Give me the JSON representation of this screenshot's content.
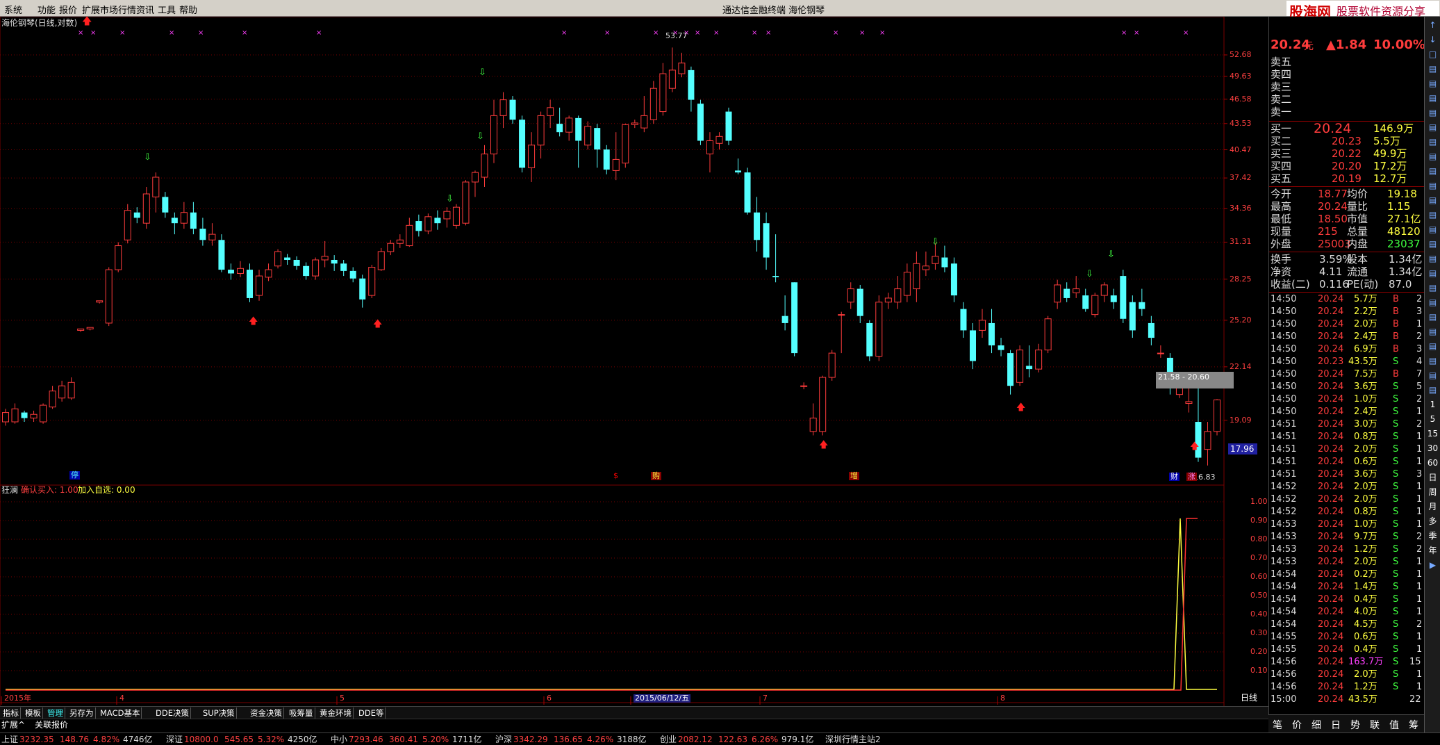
{
  "menu": [
    "系统",
    "功能",
    "报价",
    "扩展市场行情",
    "资讯",
    "工具",
    "帮助"
  ],
  "window_title": "通达信金融终端  海伦钢琴",
  "logo": {
    "name": "股海网",
    "slogan": "股票软件资源分享",
    "url": "www.Guhai.com.cn"
  },
  "chart_title": "海伦钢琴(日线,对数)",
  "yaxis_labels": [
    "52.68",
    "49.63",
    "46.58",
    "43.53",
    "40.47",
    "37.42",
    "34.36",
    "31.31",
    "28.25",
    "25.20",
    "22.14",
    "19.09"
  ],
  "price_box": "17.96",
  "high_label": "53.77",
  "low_label": "16.83",
  "range_label": "21.58 - 20.60",
  "event_labels": [
    "停",
    "$",
    "购",
    "增",
    "财",
    "涨"
  ],
  "indicator": {
    "name": "狂澜",
    "line1": "确认买入: 1.00",
    "line2": "加入自选: 0.00",
    "ticks": [
      "1.00",
      "0.90",
      "0.80",
      "0.70",
      "0.60",
      "0.50",
      "0.40",
      "0.30",
      "0.20",
      "0.10"
    ]
  },
  "xaxis_labels": [
    "2015年",
    "4",
    "5",
    "6",
    "2015/06/12/五",
    "7",
    "8"
  ],
  "period": "日线",
  "tabs": [
    "指标",
    "模板",
    "管理",
    "另存为",
    "MACD基本",
    "DDE决策",
    "SUP决策",
    "资金决策",
    "吸筹量",
    "黄金环境",
    "DDE等"
  ],
  "tabs2": [
    "扩展^",
    "关联报价"
  ],
  "quote": {
    "price": "20.24",
    "unit": "元",
    "change": "▲1.84",
    "pct": "10.00%",
    "sells": [
      {
        "label": "卖五"
      },
      {
        "label": "卖四"
      },
      {
        "label": "卖三"
      },
      {
        "label": "卖二"
      },
      {
        "label": "卖一"
      }
    ],
    "buys": [
      {
        "label": "买一",
        "price": "20.24",
        "vol": "146.9万"
      },
      {
        "label": "买二",
        "price": "20.23",
        "vol": "5.5万"
      },
      {
        "label": "买三",
        "price": "20.22",
        "vol": "49.9万"
      },
      {
        "label": "买四",
        "price": "20.20",
        "vol": "17.2万"
      },
      {
        "label": "买五",
        "price": "20.19",
        "vol": "12.7万"
      }
    ],
    "stats": [
      {
        "k1": "今开",
        "v1": "18.77",
        "k2": "均价",
        "v2": "19.18"
      },
      {
        "k1": "最高",
        "v1": "20.24",
        "k2": "量比",
        "v2": "1.15"
      },
      {
        "k1": "最低",
        "v1": "18.50",
        "k2": "市值",
        "v2": "27.1亿"
      },
      {
        "k1": "现量",
        "v1": "215",
        "k2": "总量",
        "v2": "48120"
      },
      {
        "k1": "外盘",
        "v1": "25003",
        "k2": "内盘",
        "v2": "23037"
      }
    ],
    "stats2": [
      {
        "k1": "换手",
        "v1": "3.59%",
        "k2": "股本",
        "v2": "1.34亿"
      },
      {
        "k1": "净资",
        "v1": "4.11",
        "k2": "流通",
        "v2": "1.34亿"
      },
      {
        "k1": "收益(二)",
        "v1": "0.116",
        "k2": "PE(动)",
        "v2": "87.0"
      }
    ],
    "trades": [
      [
        "14:50",
        "20.24",
        "5.7万",
        "B",
        "2"
      ],
      [
        "14:50",
        "20.24",
        "2.2万",
        "B",
        "3"
      ],
      [
        "14:50",
        "20.24",
        "2.0万",
        "B",
        "1"
      ],
      [
        "14:50",
        "20.24",
        "2.4万",
        "B",
        "2"
      ],
      [
        "14:50",
        "20.24",
        "6.9万",
        "B",
        "3"
      ],
      [
        "14:50",
        "20.23",
        "43.5万",
        "S",
        "4"
      ],
      [
        "14:50",
        "20.24",
        "7.5万",
        "B",
        "7"
      ],
      [
        "14:50",
        "20.24",
        "3.6万",
        "S",
        "5"
      ],
      [
        "14:50",
        "20.24",
        "1.0万",
        "S",
        "2"
      ],
      [
        "14:50",
        "20.24",
        "2.4万",
        "S",
        "1"
      ],
      [
        "14:51",
        "20.24",
        "3.0万",
        "S",
        "2"
      ],
      [
        "14:51",
        "20.24",
        "0.8万",
        "S",
        "1"
      ],
      [
        "14:51",
        "20.24",
        "2.0万",
        "S",
        "1"
      ],
      [
        "14:51",
        "20.24",
        "0.6万",
        "S",
        "1"
      ],
      [
        "14:51",
        "20.24",
        "3.6万",
        "S",
        "3"
      ],
      [
        "14:52",
        "20.24",
        "2.0万",
        "S",
        "1"
      ],
      [
        "14:52",
        "20.24",
        "2.0万",
        "S",
        "1"
      ],
      [
        "14:52",
        "20.24",
        "0.8万",
        "S",
        "1"
      ],
      [
        "14:53",
        "20.24",
        "1.0万",
        "S",
        "1"
      ],
      [
        "14:53",
        "20.24",
        "9.7万",
        "S",
        "2"
      ],
      [
        "14:53",
        "20.24",
        "1.2万",
        "S",
        "2"
      ],
      [
        "14:53",
        "20.24",
        "2.0万",
        "S",
        "1"
      ],
      [
        "14:54",
        "20.24",
        "0.2万",
        "S",
        "1"
      ],
      [
        "14:54",
        "20.24",
        "1.4万",
        "S",
        "1"
      ],
      [
        "14:54",
        "20.24",
        "0.4万",
        "S",
        "1"
      ],
      [
        "14:54",
        "20.24",
        "4.0万",
        "S",
        "1"
      ],
      [
        "14:54",
        "20.24",
        "4.5万",
        "S",
        "2"
      ],
      [
        "14:55",
        "20.24",
        "0.6万",
        "S",
        "1"
      ],
      [
        "14:55",
        "20.24",
        "0.4万",
        "S",
        "1"
      ],
      [
        "14:56",
        "20.24",
        "163.7万",
        "S",
        "15"
      ],
      [
        "14:56",
        "20.24",
        "2.0万",
        "S",
        "1"
      ],
      [
        "14:56",
        "20.24",
        "1.2万",
        "S",
        "1"
      ],
      [
        "15:00",
        "20.24",
        "43.5万",
        "",
        "22"
      ]
    ],
    "bottom_tabs": [
      "笔",
      "价",
      "细",
      "日",
      "势",
      "联",
      "值",
      "筹"
    ]
  },
  "sidebar_items": [
    "↑",
    "↓",
    "□",
    "▤",
    "▤",
    "▤",
    "▤",
    "▤",
    "▤",
    "▤",
    "▤",
    "▤",
    "▤",
    "▤",
    "▤",
    "▤",
    "▤",
    "▤",
    "▤",
    "▤",
    "▤",
    "▤",
    "▤",
    "▤",
    "▤",
    "▤",
    "1",
    "5",
    "15",
    "30",
    "60",
    "日",
    "周",
    "月",
    "多",
    "季",
    "年",
    "▶"
  ],
  "status": [
    {
      "name": "上证",
      "val": "3232.35",
      "chg": "148.76",
      "pct": "4.82%",
      "amt": "4746亿"
    },
    {
      "name": "深证",
      "val": "10800.0",
      "chg": "545.65",
      "pct": "5.32%",
      "amt": "4250亿"
    },
    {
      "name": "中小",
      "val": "7293.46",
      "chg": "360.41",
      "pct": "5.20%",
      "amt": "1711亿"
    },
    {
      "name": "沪深",
      "val": "3342.29",
      "chg": "136.65",
      "pct": "4.26%",
      "amt": "3188亿"
    },
    {
      "name": "创业",
      "val": "2082.12",
      "chg": "122.63",
      "pct": "6.26%",
      "amt": "979.1亿"
    }
  ],
  "status_server": "深圳行情主站2",
  "colors": {
    "up": "#ff3c3c",
    "down": "#54ffff",
    "bg": "#000000",
    "grid": "#7a0000"
  },
  "chart_data": {
    "type": "candlestick",
    "title": "海伦钢琴(日线,对数)",
    "ylim": [
      16.83,
      53.77
    ],
    "candles": [
      {
        "o": 19.0,
        "c": 19.5,
        "h": 19.7,
        "l": 18.8
      },
      {
        "o": 19.0,
        "c": 19.7,
        "h": 20.0,
        "l": 18.9
      },
      {
        "o": 19.5,
        "c": 19.2,
        "h": 19.6,
        "l": 19.0
      },
      {
        "o": 19.2,
        "c": 19.4,
        "h": 19.6,
        "l": 19.0
      },
      {
        "o": 19.0,
        "c": 19.9,
        "h": 20.0,
        "l": 18.9
      },
      {
        "o": 19.8,
        "c": 20.7,
        "h": 21.0,
        "l": 19.7
      },
      {
        "o": 20.3,
        "c": 21.0,
        "h": 21.3,
        "l": 20.1
      },
      {
        "o": 20.3,
        "c": 21.2,
        "h": 21.5,
        "l": 20.2
      },
      {
        "o": 24.5,
        "c": 24.6,
        "h": 24.6,
        "l": 24.4
      },
      {
        "o": 24.6,
        "c": 24.7,
        "h": 24.7,
        "l": 24.5
      },
      {
        "o": 26.5,
        "c": 26.6,
        "h": 26.6,
        "l": 26.4
      },
      {
        "o": 25.0,
        "c": 29.0,
        "h": 29.2,
        "l": 24.8
      },
      {
        "o": 29.0,
        "c": 31.0,
        "h": 31.3,
        "l": 28.8
      },
      {
        "o": 31.5,
        "c": 34.2,
        "h": 34.8,
        "l": 31.2
      },
      {
        "o": 34.0,
        "c": 33.5,
        "h": 34.5,
        "l": 33.0
      },
      {
        "o": 33.0,
        "c": 35.8,
        "h": 36.5,
        "l": 32.5
      },
      {
        "o": 35.5,
        "c": 37.5,
        "h": 38.0,
        "l": 34.0
      },
      {
        "o": 35.5,
        "c": 34.0,
        "h": 36.0,
        "l": 33.5
      },
      {
        "o": 33.5,
        "c": 33.0,
        "h": 34.0,
        "l": 32.0
      },
      {
        "o": 33.0,
        "c": 34.0,
        "h": 35.0,
        "l": 32.5
      },
      {
        "o": 34.0,
        "c": 32.5,
        "h": 35.0,
        "l": 32.0
      },
      {
        "o": 32.5,
        "c": 31.5,
        "h": 33.5,
        "l": 31.0
      },
      {
        "o": 31.5,
        "c": 32.0,
        "h": 33.0,
        "l": 31.0
      },
      {
        "o": 31.5,
        "c": 29.0,
        "h": 32.0,
        "l": 28.8
      },
      {
        "o": 29.0,
        "c": 28.7,
        "h": 29.5,
        "l": 28.2
      },
      {
        "o": 28.7,
        "c": 29.1,
        "h": 29.7,
        "l": 28.4
      },
      {
        "o": 29.0,
        "c": 26.8,
        "h": 29.5,
        "l": 26.5
      },
      {
        "o": 27.0,
        "c": 28.5,
        "h": 29.0,
        "l": 26.6
      },
      {
        "o": 28.4,
        "c": 29.0,
        "h": 29.5,
        "l": 28.1
      },
      {
        "o": 29.3,
        "c": 30.5,
        "h": 30.7,
        "l": 29.1
      },
      {
        "o": 30.0,
        "c": 29.8,
        "h": 30.3,
        "l": 29.4
      },
      {
        "o": 29.8,
        "c": 29.3,
        "h": 30.1,
        "l": 29.0
      },
      {
        "o": 29.3,
        "c": 28.5,
        "h": 29.6,
        "l": 28.2
      },
      {
        "o": 28.5,
        "c": 29.8,
        "h": 30.0,
        "l": 28.2
      },
      {
        "o": 29.8,
        "c": 30.1,
        "h": 31.4,
        "l": 29.2
      },
      {
        "o": 29.8,
        "c": 29.5,
        "h": 30.2,
        "l": 28.9
      },
      {
        "o": 29.5,
        "c": 28.9,
        "h": 29.8,
        "l": 28.5
      },
      {
        "o": 28.9,
        "c": 28.3,
        "h": 29.2,
        "l": 28.0
      },
      {
        "o": 28.3,
        "c": 26.7,
        "h": 28.6,
        "l": 26.1
      },
      {
        "o": 27.0,
        "c": 29.2,
        "h": 29.4,
        "l": 26.8
      },
      {
        "o": 29.0,
        "c": 30.5,
        "h": 30.8,
        "l": 28.9
      },
      {
        "o": 30.5,
        "c": 31.2,
        "h": 31.5,
        "l": 30.2
      },
      {
        "o": 31.2,
        "c": 31.5,
        "h": 32.0,
        "l": 30.8
      },
      {
        "o": 31.0,
        "c": 32.8,
        "h": 33.5,
        "l": 30.9
      },
      {
        "o": 33.2,
        "c": 32.3,
        "h": 33.8,
        "l": 31.8
      },
      {
        "o": 32.3,
        "c": 33.6,
        "h": 33.9,
        "l": 32.0
      },
      {
        "o": 33.5,
        "c": 33.0,
        "h": 34.2,
        "l": 32.4
      },
      {
        "o": 33.4,
        "c": 34.1,
        "h": 34.5,
        "l": 32.6
      },
      {
        "o": 32.8,
        "c": 34.5,
        "h": 34.8,
        "l": 32.5
      },
      {
        "o": 33.0,
        "c": 37.0,
        "h": 37.2,
        "l": 32.8
      },
      {
        "o": 37.0,
        "c": 38.0,
        "h": 38.2,
        "l": 35.5
      },
      {
        "o": 37.5,
        "c": 40.0,
        "h": 41.0,
        "l": 36.5
      },
      {
        "o": 40.0,
        "c": 44.5,
        "h": 46.5,
        "l": 39.0
      },
      {
        "o": 44.5,
        "c": 46.5,
        "h": 47.5,
        "l": 43.0
      },
      {
        "o": 46.5,
        "c": 44.0,
        "h": 47.0,
        "l": 43.5
      },
      {
        "o": 44.0,
        "c": 38.5,
        "h": 44.5,
        "l": 38.0
      },
      {
        "o": 38.5,
        "c": 41.0,
        "h": 42.5,
        "l": 37.0
      },
      {
        "o": 41.0,
        "c": 44.5,
        "h": 45.0,
        "l": 39.5
      },
      {
        "o": 44.5,
        "c": 45.5,
        "h": 46.5,
        "l": 43.0
      },
      {
        "o": 43.5,
        "c": 42.5,
        "h": 45.5,
        "l": 42.0
      },
      {
        "o": 42.5,
        "c": 44.2,
        "h": 44.5,
        "l": 41.5
      },
      {
        "o": 44.2,
        "c": 41.5,
        "h": 44.5,
        "l": 38.5
      },
      {
        "o": 41.0,
        "c": 43.2,
        "h": 43.8,
        "l": 40.5
      },
      {
        "o": 43.0,
        "c": 40.5,
        "h": 43.5,
        "l": 38.5
      },
      {
        "o": 40.5,
        "c": 38.3,
        "h": 41.0,
        "l": 37.8
      },
      {
        "o": 38.2,
        "c": 39.4,
        "h": 42.5,
        "l": 37.2
      },
      {
        "o": 39.0,
        "c": 43.4,
        "h": 43.5,
        "l": 38.5
      },
      {
        "o": 43.4,
        "c": 43.6,
        "h": 44.0,
        "l": 43.0
      },
      {
        "o": 43.0,
        "c": 44.5,
        "h": 47.0,
        "l": 42.5
      },
      {
        "o": 44.0,
        "c": 48.0,
        "h": 49.0,
        "l": 43.5
      },
      {
        "o": 45.0,
        "c": 50.0,
        "h": 51.5,
        "l": 44.5
      },
      {
        "o": 48.0,
        "c": 50.5,
        "h": 53.77,
        "l": 47.5
      },
      {
        "o": 50.0,
        "c": 51.5,
        "h": 53.0,
        "l": 49.5
      },
      {
        "o": 50.5,
        "c": 46.5,
        "h": 51.0,
        "l": 45.0
      },
      {
        "o": 46.0,
        "c": 41.5,
        "h": 46.5,
        "l": 41.0
      },
      {
        "o": 40.0,
        "c": 41.5,
        "h": 42.5,
        "l": 38.0
      },
      {
        "o": 41.2,
        "c": 42.0,
        "h": 42.5,
        "l": 40.5
      },
      {
        "o": 45.0,
        "c": 41.5,
        "h": 45.5,
        "l": 41.0
      },
      {
        "o": 38.2,
        "c": 38.0,
        "h": 39.5,
        "l": 37.8
      },
      {
        "o": 38.0,
        "c": 34.0,
        "h": 38.5,
        "l": 33.8
      },
      {
        "o": 34.0,
        "c": 31.5,
        "h": 35.5,
        "l": 30.5
      },
      {
        "o": 33.0,
        "c": 30.0,
        "h": 34.0,
        "l": 29.0
      },
      {
        "o": 28.5,
        "c": 28.4,
        "h": 32.0,
        "l": 28.0
      },
      {
        "o": 25.5,
        "c": 25.0,
        "h": 27.0,
        "l": 24.5
      },
      {
        "o": 28.0,
        "c": 23.0,
        "h": 28.0,
        "l": 22.8
      },
      {
        "o": 21.0,
        "c": 21.0,
        "h": 21.2,
        "l": 20.8
      },
      {
        "o": 18.5,
        "c": 19.2,
        "h": 20.0,
        "l": 18.3
      },
      {
        "o": 18.5,
        "c": 21.5,
        "h": 21.6,
        "l": 18.3
      },
      {
        "o": 21.5,
        "c": 23.0,
        "h": 23.2,
        "l": 21.3
      },
      {
        "o": 25.6,
        "c": 25.6,
        "h": 25.8,
        "l": 23.0
      },
      {
        "o": 26.5,
        "c": 27.5,
        "h": 28.0,
        "l": 26.0
      },
      {
        "o": 27.5,
        "c": 25.5,
        "h": 27.8,
        "l": 25.0
      },
      {
        "o": 25.0,
        "c": 22.8,
        "h": 25.2,
        "l": 22.5
      },
      {
        "o": 22.8,
        "c": 26.5,
        "h": 27.0,
        "l": 22.5
      },
      {
        "o": 26.5,
        "c": 26.8,
        "h": 27.2,
        "l": 26.0
      },
      {
        "o": 26.5,
        "c": 27.5,
        "h": 28.5,
        "l": 26.0
      },
      {
        "o": 27.0,
        "c": 28.8,
        "h": 29.5,
        "l": 26.5
      },
      {
        "o": 27.5,
        "c": 29.5,
        "h": 30.5,
        "l": 26.5
      },
      {
        "o": 29.0,
        "c": 29.3,
        "h": 30.5,
        "l": 28.5
      },
      {
        "o": 29.5,
        "c": 30.1,
        "h": 31.2,
        "l": 29.0
      },
      {
        "o": 30.0,
        "c": 29.2,
        "h": 31.0,
        "l": 28.8
      },
      {
        "o": 29.5,
        "c": 27.0,
        "h": 30.0,
        "l": 26.5
      },
      {
        "o": 26.0,
        "c": 24.5,
        "h": 26.5,
        "l": 24.0
      },
      {
        "o": 24.5,
        "c": 22.5,
        "h": 25.0,
        "l": 22.0
      },
      {
        "o": 24.5,
        "c": 25.2,
        "h": 26.0,
        "l": 24.0
      },
      {
        "o": 25.0,
        "c": 23.5,
        "h": 26.0,
        "l": 23.0
      },
      {
        "o": 23.5,
        "c": 23.2,
        "h": 24.0,
        "l": 22.8
      },
      {
        "o": 23.0,
        "c": 21.0,
        "h": 23.2,
        "l": 20.5
      },
      {
        "o": 21.2,
        "c": 23.2,
        "h": 23.5,
        "l": 21.0
      },
      {
        "o": 22.2,
        "c": 22.0,
        "h": 23.5,
        "l": 21.5
      },
      {
        "o": 22.0,
        "c": 23.2,
        "h": 23.6,
        "l": 21.8
      },
      {
        "o": 23.2,
        "c": 25.3,
        "h": 25.5,
        "l": 23.0
      },
      {
        "o": 26.5,
        "c": 27.8,
        "h": 28.2,
        "l": 26.0
      },
      {
        "o": 27.5,
        "c": 26.8,
        "h": 28.0,
        "l": 26.5
      },
      {
        "o": 27.2,
        "c": 27.5,
        "h": 28.5,
        "l": 26.8
      },
      {
        "o": 27.0,
        "c": 26.0,
        "h": 27.5,
        "l": 25.8
      },
      {
        "o": 25.6,
        "c": 27.0,
        "h": 27.2,
        "l": 25.4
      },
      {
        "o": 27.0,
        "c": 27.8,
        "h": 28.0,
        "l": 26.5
      },
      {
        "o": 27.0,
        "c": 26.5,
        "h": 27.5,
        "l": 26.0
      },
      {
        "o": 28.5,
        "c": 25.3,
        "h": 29.0,
        "l": 25.0
      },
      {
        "o": 26.5,
        "c": 24.5,
        "h": 27.0,
        "l": 24.0
      },
      {
        "o": 26.5,
        "c": 26.0,
        "h": 27.5,
        "l": 25.5
      },
      {
        "o": 25.0,
        "c": 24.0,
        "h": 25.5,
        "l": 23.5
      },
      {
        "o": 23.0,
        "c": 23.0,
        "h": 23.5,
        "l": 22.7
      },
      {
        "o": 22.7,
        "c": 21.0,
        "h": 23.0,
        "l": 20.5
      },
      {
        "o": 20.5,
        "c": 21.5,
        "h": 21.8,
        "l": 20.3
      },
      {
        "o": 20.0,
        "c": 20.1,
        "h": 21.0,
        "l": 19.5
      },
      {
        "o": 19.0,
        "c": 17.2,
        "h": 21.0,
        "l": 17.0
      },
      {
        "o": 17.6,
        "c": 18.5,
        "h": 19.0,
        "l": 16.83
      },
      {
        "o": 18.5,
        "c": 20.2,
        "h": 20.24,
        "l": 18.3
      }
    ]
  }
}
